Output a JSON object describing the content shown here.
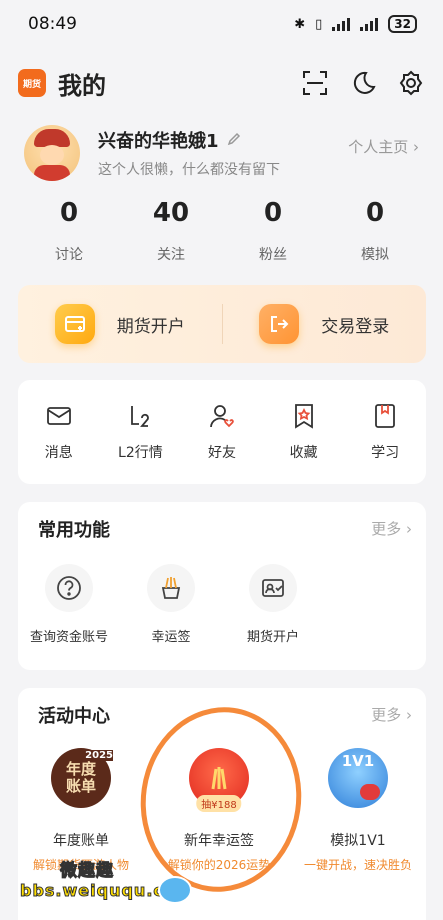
{
  "status_bar": {
    "time": "08:49",
    "battery": "32"
  },
  "header": {
    "logo_text": "期货",
    "title": "我的",
    "icons": [
      "scan-icon",
      "moon-icon",
      "gear-icon"
    ]
  },
  "profile": {
    "name": "兴奋的华艳娥1",
    "description": "这个人很懒，什么都没有留下",
    "homepage_label": "个人主页"
  },
  "stats": [
    {
      "value": "0",
      "label": "讨论"
    },
    {
      "value": "40",
      "label": "关注"
    },
    {
      "value": "0",
      "label": "粉丝"
    },
    {
      "value": "0",
      "label": "模拟"
    }
  ],
  "banner": {
    "left_label": "期货开户",
    "right_label": "交易登录"
  },
  "quick_menu": [
    {
      "label": "消息",
      "icon": "mail-icon"
    },
    {
      "label": "L2行情",
      "icon": "l2-icon"
    },
    {
      "label": "好友",
      "icon": "friend-icon"
    },
    {
      "label": "收藏",
      "icon": "star-icon"
    },
    {
      "label": "学习",
      "icon": "book-icon"
    }
  ],
  "common": {
    "title": "常用功能",
    "more": "更多",
    "items": [
      {
        "label": "查询资金账号",
        "icon": "question-icon"
      },
      {
        "label": "幸运签",
        "icon": "lucky-icon"
      },
      {
        "label": "期货开户",
        "icon": "account-icon"
      }
    ]
  },
  "activity": {
    "title": "活动中心",
    "more": "更多",
    "items": [
      {
        "label": "年度账单",
        "sub": "解锁期货西游人物",
        "badge_year": "2025",
        "badge_text1": "年度",
        "badge_text2": "账单"
      },
      {
        "label": "新年幸运签",
        "sub": "解锁你的2026运势",
        "badge": "抽¥188"
      },
      {
        "label": "模拟1V1",
        "sub": "一键开战，速决胜负",
        "badge": "1V1"
      }
    ]
  },
  "watermark": {
    "line1": "微趣趣",
    "line2": "bbs.weiququ.cn"
  },
  "colors": {
    "accent": "#f26b1d",
    "annotation": "#f58a3a",
    "subtext": "#f08a2f"
  }
}
